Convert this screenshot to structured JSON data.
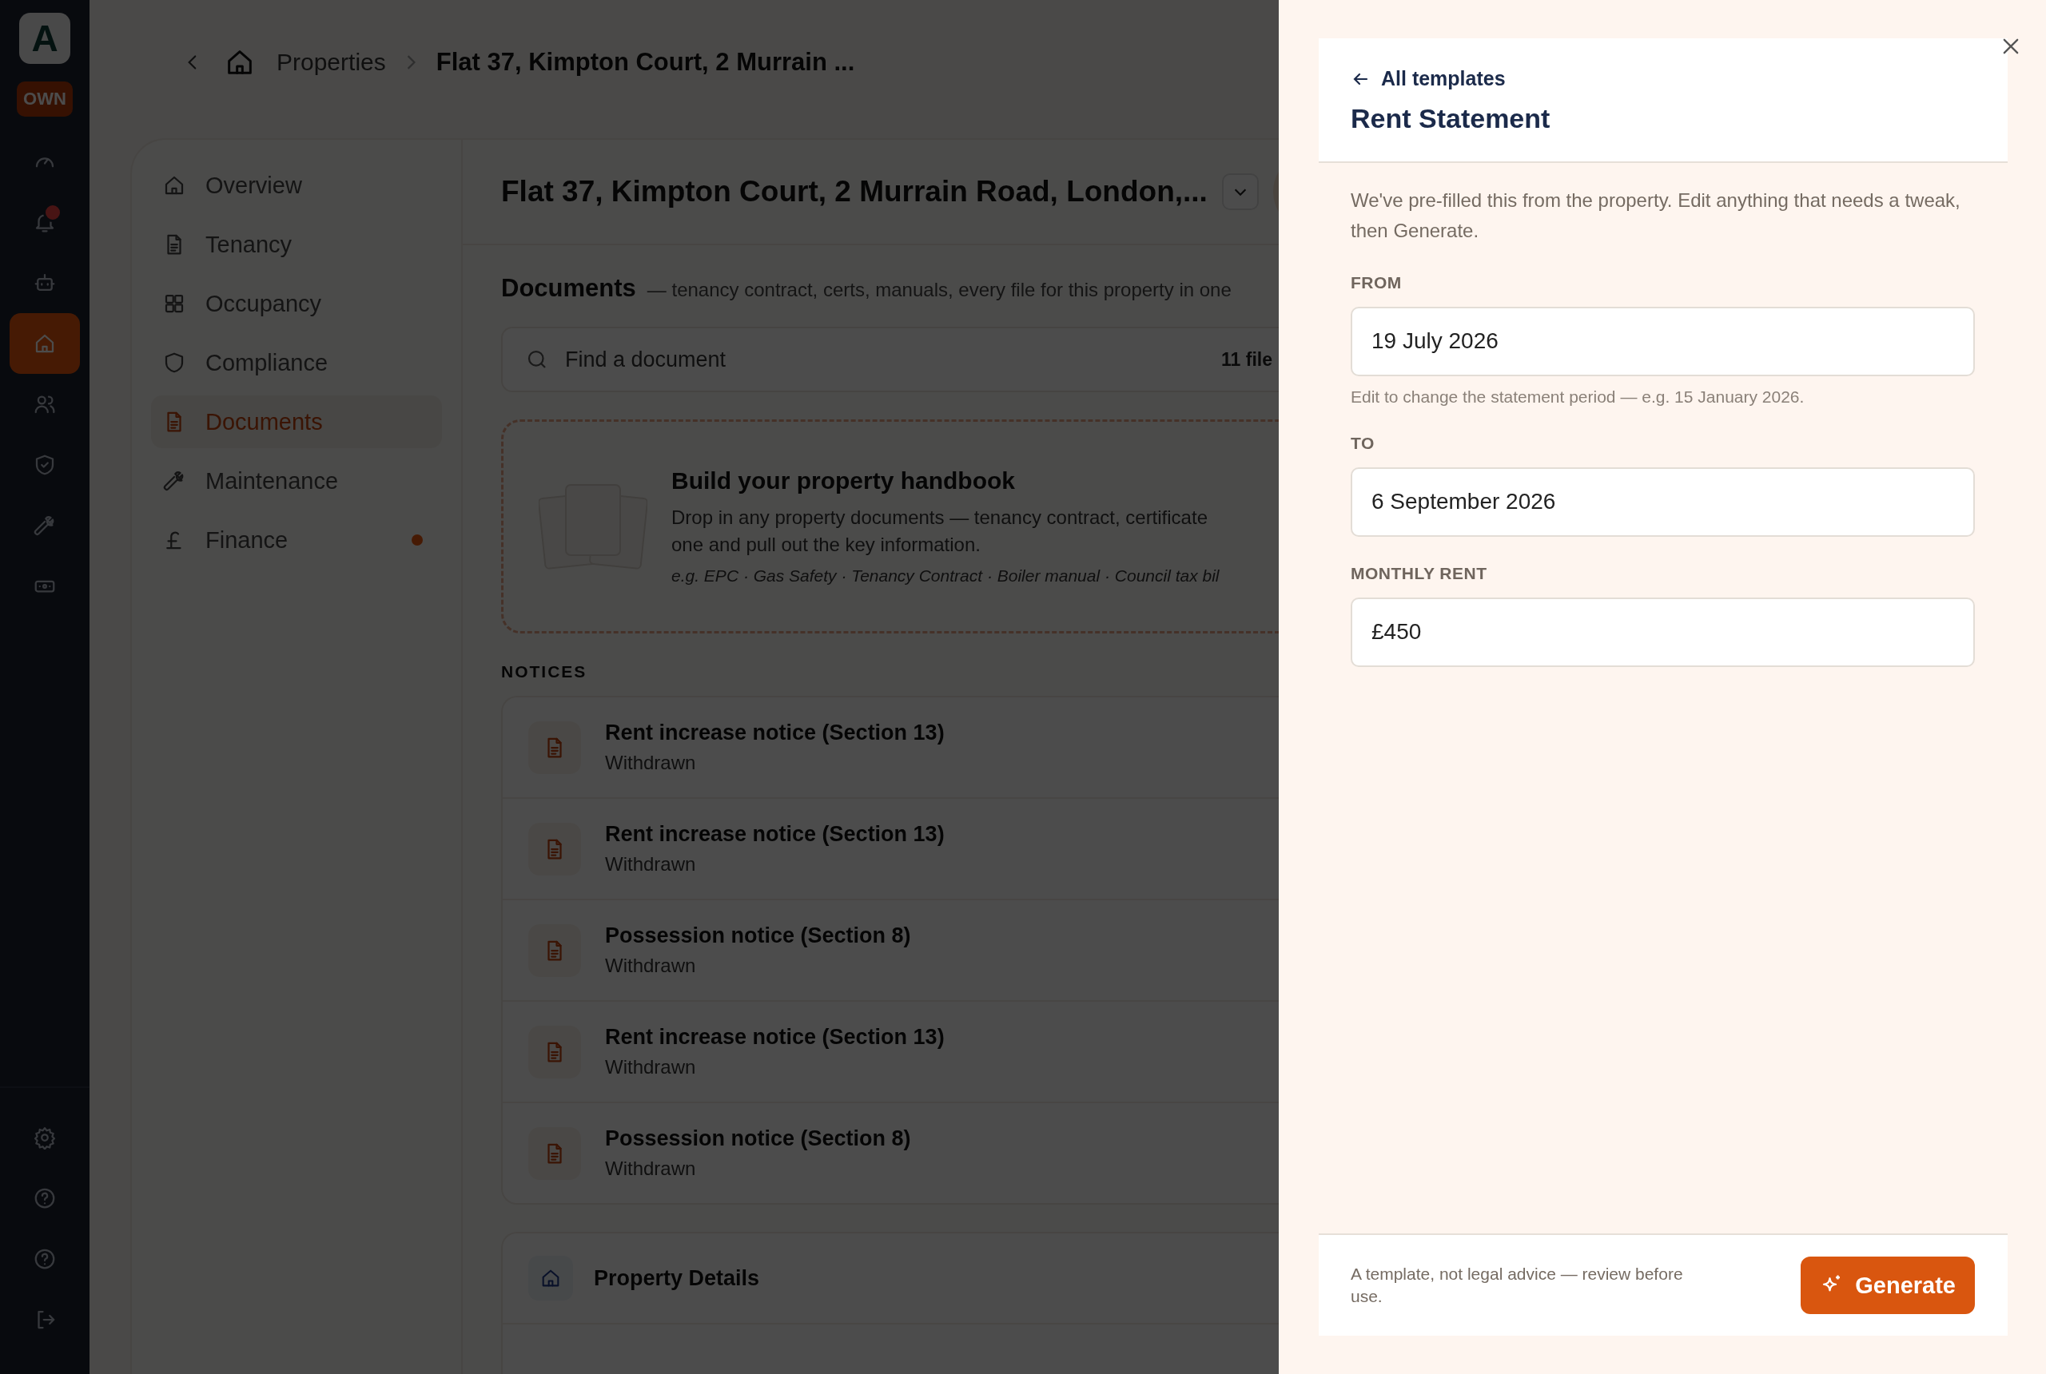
{
  "rail": {
    "logo": "A",
    "workspace_badge": "OWN",
    "items": [
      {
        "selected": false,
        "alert": false
      },
      {
        "selected": false,
        "alert": true
      },
      {
        "selected": false,
        "alert": false
      },
      {
        "selected": true,
        "alert": false
      },
      {
        "selected": false,
        "alert": false
      },
      {
        "selected": false,
        "alert": false
      },
      {
        "selected": false,
        "alert": false
      },
      {
        "selected": false,
        "alert": false
      }
    ]
  },
  "breadcrumb": {
    "parent": "Properties",
    "current": "Flat 37, Kimpton Court, 2 Murrain ..."
  },
  "subnav": {
    "items": [
      {
        "label": "Overview",
        "selected": false,
        "alert": false
      },
      {
        "label": "Tenancy",
        "selected": false,
        "alert": false
      },
      {
        "label": "Occupancy",
        "selected": false,
        "alert": false
      },
      {
        "label": "Compliance",
        "selected": false,
        "alert": false
      },
      {
        "label": "Documents",
        "selected": true,
        "alert": false
      },
      {
        "label": "Maintenance",
        "selected": false,
        "alert": false
      },
      {
        "label": "Finance",
        "selected": false,
        "alert": true
      }
    ]
  },
  "property_title": "Flat 37, Kimpton Court, 2 Murrain Road, London,...",
  "documents": {
    "title": "Documents",
    "subtitle": "— tenancy contract, certs, manuals, every file for this property in one",
    "search": {
      "placeholder": "Find a document",
      "count": "11 file"
    },
    "handbook": {
      "title": "Build your property handbook",
      "description": [
        "Drop in any property documents — tenancy contract, certificate",
        "one and pull out the key information."
      ],
      "examples": "e.g. EPC · Gas Safety · Tenancy Contract · Boiler manual · Council tax bil"
    }
  },
  "notices": {
    "heading": "NOTICES",
    "items": [
      {
        "title": "Rent increase notice (Section 13)",
        "status": "Withdrawn"
      },
      {
        "title": "Rent increase notice (Section 13)",
        "status": "Withdrawn"
      },
      {
        "title": "Possession notice (Section 8)",
        "status": "Withdrawn"
      },
      {
        "title": "Rent increase notice (Section 13)",
        "status": "Withdrawn"
      },
      {
        "title": "Possession notice (Section 8)",
        "status": "Withdrawn"
      }
    ]
  },
  "property_details": {
    "title": "Property Details"
  },
  "drawer": {
    "back_link": "All templates",
    "title": "Rent Statement",
    "intro": "We've pre-filled this from the property. Edit anything that needs a tweak, then Generate.",
    "fields": [
      {
        "label": "FROM",
        "value": "19 July 2026",
        "hint": "Edit to change the statement period — e.g. 15 January 2026."
      },
      {
        "label": "TO",
        "value": "6 September 2026"
      },
      {
        "label": "MONTHLY RENT",
        "value": "£450"
      }
    ],
    "footer": {
      "note": "A template, not legal advice — review before use.",
      "button": "Generate"
    }
  }
}
